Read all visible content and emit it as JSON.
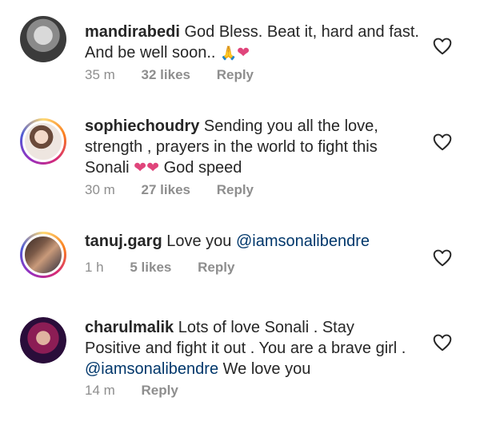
{
  "comments": [
    {
      "username": "mandirabedi",
      "text_line1": "God Bless. Beat it, hard and fast.",
      "text_line2": "And be well soon..",
      "emojis": [
        "🙏",
        "❤"
      ],
      "time": "35 m",
      "likes": "32 likes",
      "reply": "Reply"
    },
    {
      "username": "sophiechoudry",
      "text_line1": "Sending you all the love,",
      "text_line2": "strength , prayers in the world  to fight this",
      "text_line3": "Sonali",
      "emojis": [
        "❤",
        "❤"
      ],
      "text_after": "God speed",
      "time": "30 m",
      "likes": "27 likes",
      "reply": "Reply"
    },
    {
      "username": "tanuj.garg",
      "text": "Love you",
      "mention": "@iamsonalibendre",
      "time": "1 h",
      "likes": "5 likes",
      "reply": "Reply"
    },
    {
      "username": "charulmalik",
      "text_line1": "Lots of love Sonali . Stay",
      "text_line2": "Positive and fight it out . You are a brave girl .",
      "mention": "@iamsonalibendre",
      "text_after": "We love you",
      "time": "14 m",
      "reply": "Reply"
    }
  ],
  "colors": {
    "text": "#262626",
    "meta": "#8e8e8e",
    "mention": "#00376b",
    "heart_emoji": "#e0457b"
  },
  "icons": {
    "like": "heart-outline-icon"
  }
}
